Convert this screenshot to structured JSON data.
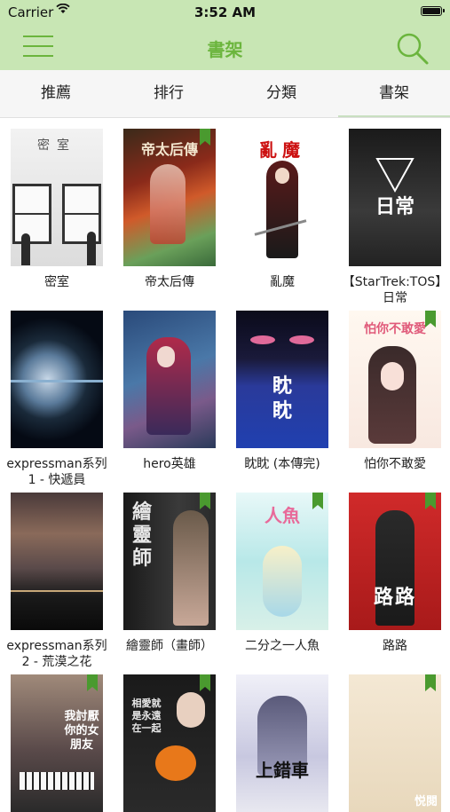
{
  "status_bar": {
    "carrier": "Carrier",
    "time": "3:52 AM"
  },
  "nav": {
    "title": "書架"
  },
  "tabs": [
    {
      "label": "推薦"
    },
    {
      "label": "排行"
    },
    {
      "label": "分類"
    },
    {
      "label": "書架",
      "active": true
    }
  ],
  "books": [
    {
      "title": "密室",
      "cover_text": "密室"
    },
    {
      "title": "帝太后傳",
      "cover_text": "帝太后傳",
      "bookmarked": true
    },
    {
      "title": "亂魔",
      "cover_text": "亂魔"
    },
    {
      "title": "【StarTrek:TOS】日常",
      "cover_text": "日常"
    },
    {
      "title": "expressman系列1 - 快遞員",
      "cover_text": ""
    },
    {
      "title": "hero英雄",
      "cover_text": ""
    },
    {
      "title": "眈眈 (本傳完)",
      "cover_text": "眈眈"
    },
    {
      "title": "怕你不敢愛",
      "cover_text": "怕你不敢愛",
      "bookmarked": true
    },
    {
      "title": "expressman系列2 - 荒漠之花",
      "cover_text": ""
    },
    {
      "title": "繪靈師（畫師）",
      "cover_text": "繪靈師",
      "bookmarked": true
    },
    {
      "title": "二分之一人魚",
      "cover_text": "人魚",
      "bookmarked": true
    },
    {
      "title": "路路",
      "cover_text": "路路",
      "bookmarked": true
    },
    {
      "title": "",
      "cover_text": "我討厭你的女朋友",
      "bookmarked": true
    },
    {
      "title": "",
      "cover_text": "相愛就是永遠在一起",
      "bookmarked": true
    },
    {
      "title": "",
      "cover_text": "上錯車"
    },
    {
      "title": "",
      "cover_text": "悦閱",
      "bookmarked": true
    }
  ]
}
